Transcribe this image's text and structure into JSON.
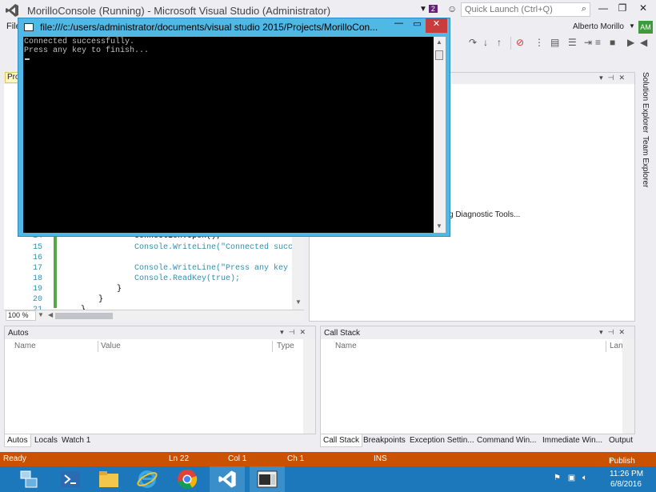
{
  "window": {
    "title": "MorilloConsole (Running) - Microsoft Visual Studio (Administrator)",
    "notification_count": "2",
    "quick_launch_placeholder": "Quick Launch (Ctrl+Q)"
  },
  "menu": {
    "file_label": "File"
  },
  "user": {
    "name": "Alberto Morillo",
    "initials": "AM"
  },
  "doc_tab": {
    "label": "Pro"
  },
  "editor": {
    "lines": [
      {
        "num": "14",
        "code": "connection.Open();"
      },
      {
        "num": "15",
        "code": "Console.WriteLine(\"Connected succes"
      },
      {
        "num": "16",
        "code": ""
      },
      {
        "num": "17",
        "code": "Console.WriteLine(\"Press any key to"
      },
      {
        "num": "18",
        "code": "Console.ReadKey(true);"
      },
      {
        "num": "19",
        "code": "}"
      },
      {
        "num": "20",
        "code": "}"
      },
      {
        "num": "21",
        "code": "}"
      }
    ],
    "zoom": "100 %"
  },
  "diagnostics": {
    "text": "g Diagnostic Tools..."
  },
  "side_tabs": [
    "Solution Explorer",
    "Team Explorer"
  ],
  "autos": {
    "title": "Autos",
    "columns": [
      "Name",
      "Value",
      "Type"
    ],
    "tabs": [
      "Autos",
      "Locals",
      "Watch 1"
    ]
  },
  "callstack": {
    "title": "Call Stack",
    "columns": [
      "Name",
      "Lang"
    ],
    "tabs": [
      "Call Stack",
      "Breakpoints",
      "Exception Settin...",
      "Command Win...",
      "Immediate Win...",
      "Output"
    ]
  },
  "statusbar": {
    "state": "Ready",
    "line": "Ln 22",
    "col": "Col 1",
    "ch": "Ch 1",
    "mode": "INS",
    "publish": "Publish"
  },
  "console": {
    "title": "file:///c:/users/administrator/documents/visual studio 2015/Projects/MorilloCon...",
    "output": [
      "Connected successfully.",
      "Press any key to finish..."
    ]
  },
  "taskbar": {
    "apps": [
      "server-manager-icon",
      "powershell-icon",
      "file-explorer-icon",
      "internet-explorer-icon",
      "chrome-icon",
      "visual-studio-icon",
      "console-window-icon"
    ],
    "time": "11:26 PM",
    "date": "6/8/2016"
  },
  "colors": {
    "statusbar": "#ca5100",
    "taskbar": "#1c78ba",
    "console_frame": "#4fb8e4",
    "close_button": "#c73d3d"
  }
}
